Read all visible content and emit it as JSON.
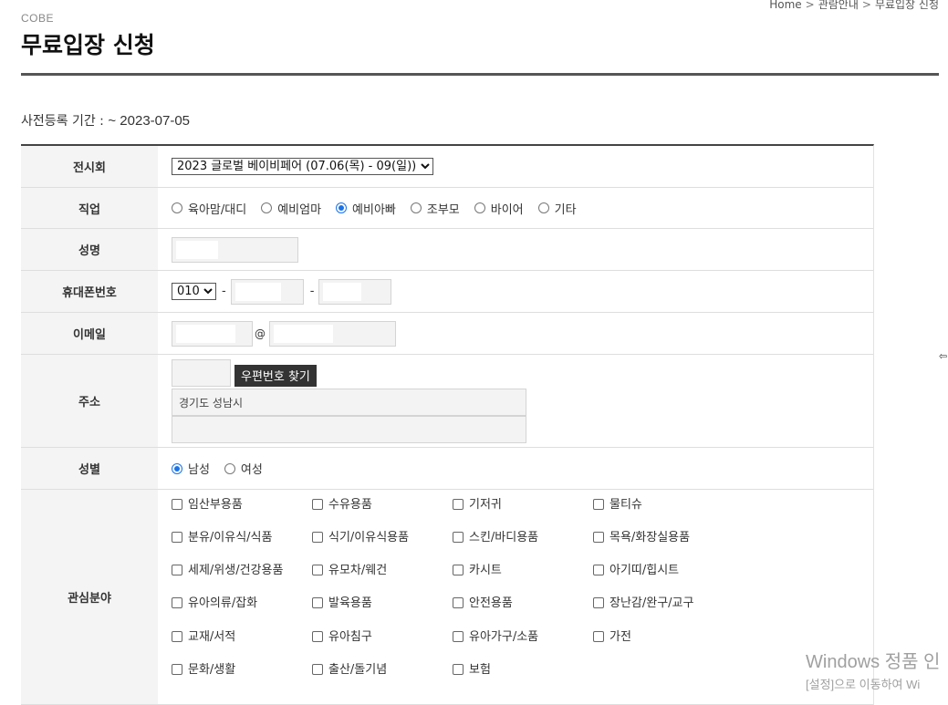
{
  "breadcrumb": {
    "home": "Home",
    "level1": "관람안내",
    "level2": "무료입장 신청",
    "separator": ">"
  },
  "header": {
    "site_name": "COBE",
    "title": "무료입장 신청"
  },
  "period": {
    "label": "사전등록 기간 :",
    "value": "~ 2023-07-05"
  },
  "form": {
    "exhibition": {
      "label": "전시회",
      "selected": "2023 글로벌 베이비페어 (07.06(목) - 09(일))"
    },
    "job": {
      "label": "직업",
      "options": [
        "육아맘/대디",
        "예비엄마",
        "예비아빠",
        "조부모",
        "바이어",
        "기타"
      ],
      "selected_index": 2
    },
    "name": {
      "label": "성명"
    },
    "phone": {
      "label": "휴대폰번호",
      "prefix": "010",
      "dash": "-"
    },
    "email": {
      "label": "이메일",
      "at": "@"
    },
    "address": {
      "label": "주소",
      "zip_button": "우편번호 찾기",
      "line1": "경기도 성남시",
      "line2": ""
    },
    "gender": {
      "label": "성별",
      "options": [
        "남성",
        "여성"
      ],
      "selected_index": 0
    },
    "interests": {
      "label": "관심분야",
      "items": [
        "임산부용품",
        "수유용품",
        "기저귀",
        "물티슈",
        "분유/이유식/식품",
        "식기/이유식용품",
        "스킨/바디용품",
        "목욕/화장실용품",
        "세제/위생/건강용품",
        "유모차/웨건",
        "카시트",
        "아기띠/힙시트",
        "유아의류/잡화",
        "발육용품",
        "안전용품",
        "장난감/완구/교구",
        "교재/서적",
        "유아침구",
        "유아가구/소품",
        "가전",
        "문화/생활",
        "출산/돌기념",
        "보험"
      ]
    }
  },
  "cursor_glyph": "⇦",
  "watermark": {
    "line1": "Windows 정품 인",
    "line2": "[설정]으로 이동하여 Wi"
  }
}
